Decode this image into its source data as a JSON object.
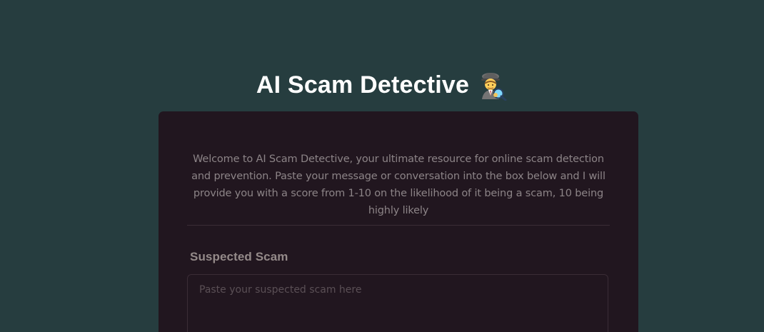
{
  "header": {
    "title": "AI Scam Detective",
    "icon": "detective-emoji-icon"
  },
  "card": {
    "intro": "Welcome to AI Scam Detective, your ultimate resource for online scam detection and prevention. Paste your message or conversation into the box below and I will provide you with a score from 1-10 on the likelihood of it being a scam, 10 being highly likely",
    "field_label": "Suspected Scam",
    "input_placeholder": "Paste your suspected scam here",
    "input_value": ""
  },
  "colors": {
    "background": "#263d3f",
    "card": "#21161f",
    "title": "#ffffff",
    "body_text": "#8c8487"
  }
}
